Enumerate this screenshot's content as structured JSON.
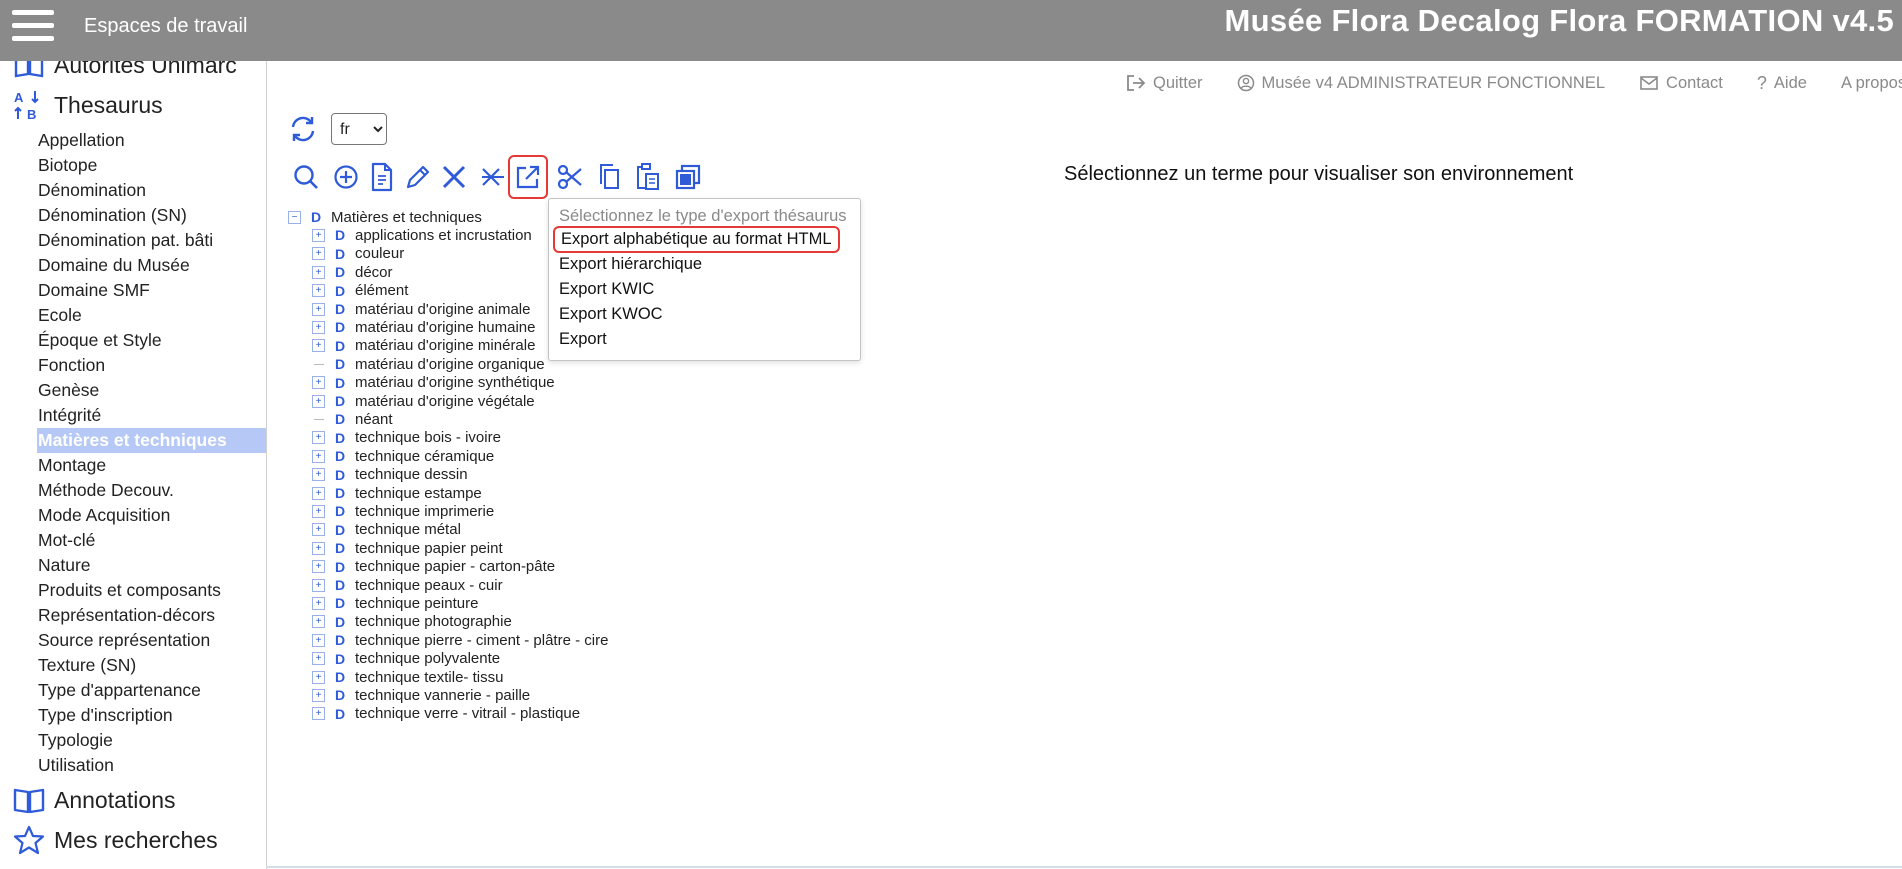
{
  "header": {
    "workspaces_label": "Espaces de travail",
    "app_title": "Musée Flora Decalog Flora FORMATION v4.5"
  },
  "sidebar": {
    "prev_section_label": "Autorités Unimarc",
    "thesaurus_label": "Thesaurus",
    "thesaurus_items": [
      "Appellation",
      "Biotope",
      "Dénomination",
      "Dénomination (SN)",
      "Dénomination pat. bâti",
      "Domaine du Musée",
      "Domaine SMF",
      "Ecole",
      "Époque et Style",
      "Fonction",
      "Genèse",
      "Intégrité",
      "Matières et techniques",
      "Montage",
      "Méthode Decouv.",
      "Mode Acquisition",
      "Mot-clé",
      "Nature",
      "Produits et composants",
      "Représentation-décors",
      "Source représentation",
      "Texture (SN)",
      "Type d'appartenance",
      "Type d'inscription",
      "Typologie",
      "Utilisation"
    ],
    "active_item": "Matières et techniques",
    "annotations_label": "Annotations",
    "searches_label": "Mes recherches"
  },
  "toplinks": {
    "quit": "Quitter",
    "user": "Musée v4 ADMINISTRATEUR FONCTIONNEL",
    "contact": "Contact",
    "help": "Aide",
    "about": "A propos"
  },
  "controls": {
    "language_selected": "fr",
    "language_options": [
      "fr"
    ]
  },
  "toolbar_icons": [
    "search-icon",
    "add-icon",
    "document-icon",
    "edit-icon",
    "delete-icon",
    "delete-multiple-icon",
    "export-icon",
    "cut-icon",
    "copy-icon",
    "paste-icon",
    "duplicate-icon"
  ],
  "message": "Sélectionnez un terme pour visualiser son environnement",
  "tree": {
    "root": "Matières et techniques",
    "marker": "D",
    "children": [
      {
        "label": "applications et incrustation",
        "expandable": true
      },
      {
        "label": "couleur",
        "expandable": true
      },
      {
        "label": "décor",
        "expandable": true
      },
      {
        "label": "élément",
        "expandable": true
      },
      {
        "label": "matériau d'origine animale",
        "expandable": true
      },
      {
        "label": "matériau d'origine humaine",
        "expandable": true
      },
      {
        "label": "matériau d'origine minérale",
        "expandable": true
      },
      {
        "label": "matériau d'origine organique",
        "expandable": false
      },
      {
        "label": "matériau d'origine synthétique",
        "expandable": true
      },
      {
        "label": "matériau d'origine végétale",
        "expandable": true
      },
      {
        "label": "néant",
        "expandable": false
      },
      {
        "label": "technique bois - ivoire",
        "expandable": true
      },
      {
        "label": "technique céramique",
        "expandable": true
      },
      {
        "label": "technique dessin",
        "expandable": true
      },
      {
        "label": "technique estampe",
        "expandable": true
      },
      {
        "label": "technique imprimerie",
        "expandable": true
      },
      {
        "label": "technique métal",
        "expandable": true
      },
      {
        "label": "technique papier peint",
        "expandable": true
      },
      {
        "label": "technique papier - carton-pâte",
        "expandable": true
      },
      {
        "label": "technique peaux - cuir",
        "expandable": true
      },
      {
        "label": "technique peinture",
        "expandable": true
      },
      {
        "label": "technique photographie",
        "expandable": true
      },
      {
        "label": "technique pierre - ciment - plâtre - cire",
        "expandable": true
      },
      {
        "label": "technique polyvalente",
        "expandable": true
      },
      {
        "label": "technique textile- tissu",
        "expandable": true
      },
      {
        "label": "technique vannerie - paille",
        "expandable": true
      },
      {
        "label": "technique verre - vitrail - plastique",
        "expandable": true
      }
    ]
  },
  "export_menu": {
    "header": "Sélectionnez le type d'export thésaurus",
    "items": [
      "Export alphabétique au format HTML",
      "Export hiérarchique",
      "Export KWIC",
      "Export KWOC",
      "Export"
    ],
    "selected": "Export alphabétique au format HTML"
  },
  "colors": {
    "header_bg": "#8a8a8a",
    "accent_blue": "#2f5bd8",
    "active_item_bg": "#b6c8f5",
    "highlight_red": "#e53935"
  }
}
